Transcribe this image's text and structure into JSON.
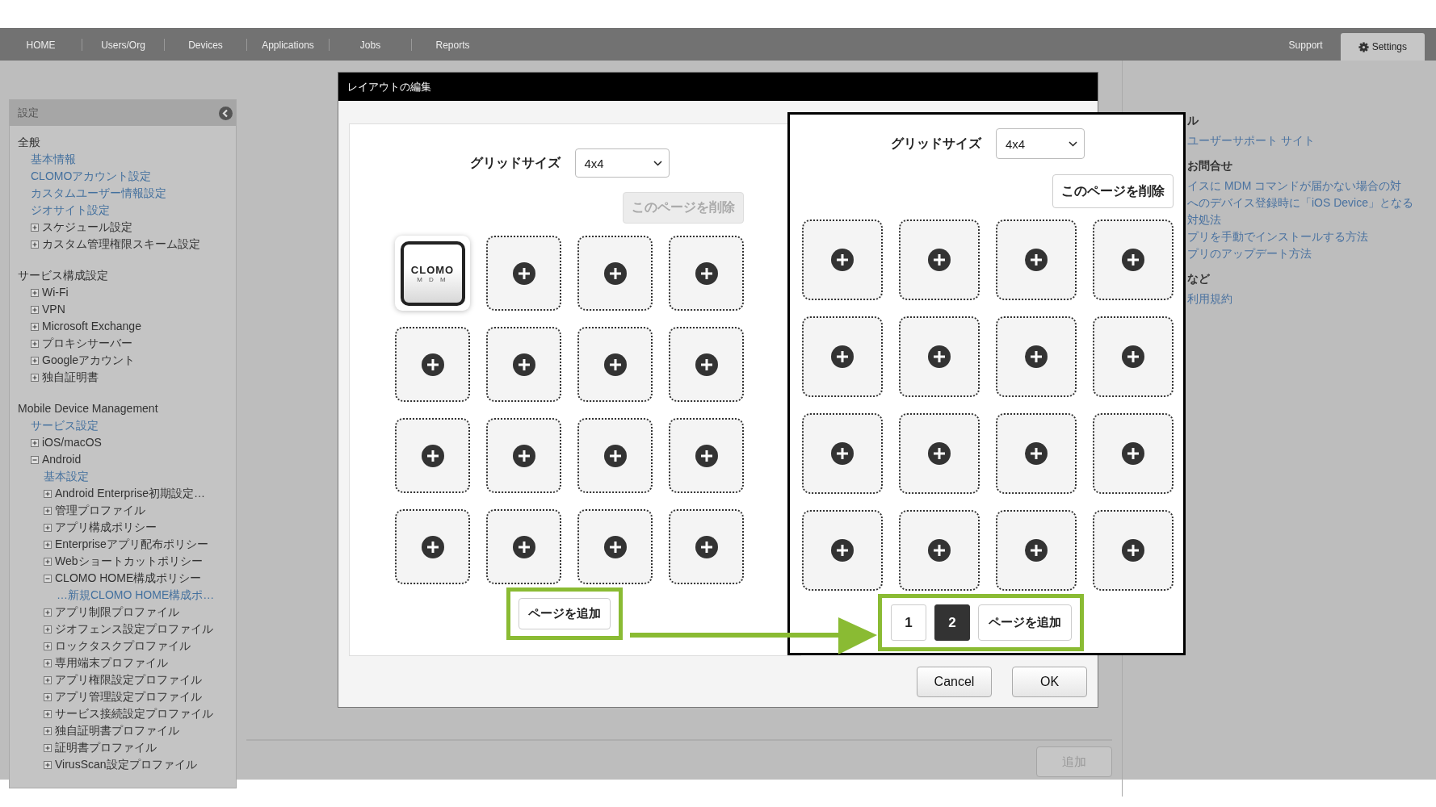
{
  "nav": {
    "tabs": [
      {
        "label": "HOME",
        "selected": false
      },
      {
        "label": "Users/Org",
        "selected": false
      },
      {
        "label": "Devices",
        "selected": false
      },
      {
        "label": "Applications",
        "selected": false
      },
      {
        "label": "Jobs",
        "selected": false
      },
      {
        "label": "Reports",
        "selected": false
      }
    ],
    "right_tabs": [
      {
        "label": "Support",
        "selected": false,
        "kind": "text"
      },
      {
        "label": "Settings",
        "selected": true,
        "kind": "gear"
      }
    ]
  },
  "sidebar": {
    "title": "設定",
    "sections": [
      {
        "heading": "全般",
        "items": [
          {
            "kind": "link",
            "label": "基本情報"
          },
          {
            "kind": "link",
            "label": "CLOMOアカウント設定"
          },
          {
            "kind": "link",
            "label": "カスタムユーザー情報設定"
          },
          {
            "kind": "link",
            "label": "ジオサイト設定"
          },
          {
            "kind": "node",
            "label": "スケジュール設定",
            "expanded": false
          },
          {
            "kind": "node",
            "label": "カスタム管理権限スキーム設定",
            "expanded": false
          }
        ]
      },
      {
        "heading": "サービス構成設定",
        "items": [
          {
            "kind": "node",
            "label": "Wi-Fi",
            "expanded": false
          },
          {
            "kind": "node",
            "label": "VPN",
            "expanded": false
          },
          {
            "kind": "node",
            "label": "Microsoft Exchange",
            "expanded": false
          },
          {
            "kind": "node",
            "label": "プロキシサーバー",
            "expanded": false
          },
          {
            "kind": "node",
            "label": "Googleアカウント",
            "expanded": false
          },
          {
            "kind": "node",
            "label": "独自証明書",
            "expanded": false
          }
        ]
      },
      {
        "heading": "Mobile Device Management",
        "items": [
          {
            "kind": "link",
            "label": "サービス設定"
          },
          {
            "kind": "node",
            "label": "iOS/macOS",
            "expanded": false
          },
          {
            "kind": "node",
            "label": "Android",
            "expanded": true,
            "children": [
              {
                "kind": "link",
                "label": "基本設定"
              },
              {
                "kind": "node",
                "label": "Android Enterprise初期設定…",
                "expanded": false
              },
              {
                "kind": "node",
                "label": "管理プロファイル",
                "expanded": false
              },
              {
                "kind": "node",
                "label": "アプリ構成ポリシー",
                "expanded": false
              },
              {
                "kind": "node",
                "label": "Enterpriseアプリ配布ポリシー",
                "expanded": false
              },
              {
                "kind": "node",
                "label": "Webショートカットポリシー",
                "expanded": false
              },
              {
                "kind": "node",
                "label": "CLOMO HOME構成ポリシー",
                "expanded": true,
                "children": [
                  {
                    "kind": "link",
                    "label": "…新規CLOMO HOME構成ポ…"
                  }
                ]
              },
              {
                "kind": "node",
                "label": "アプリ制限プロファイル",
                "expanded": false
              },
              {
                "kind": "node",
                "label": "ジオフェンス設定プロファイル",
                "expanded": false
              },
              {
                "kind": "node",
                "label": "ロックタスクプロファイル",
                "expanded": false
              },
              {
                "kind": "node",
                "label": "専用端末プロファイル",
                "expanded": false
              },
              {
                "kind": "node",
                "label": "アプリ権限設定プロファイル",
                "expanded": false
              },
              {
                "kind": "node",
                "label": "アプリ管理設定プロファイル",
                "expanded": false
              },
              {
                "kind": "node",
                "label": "サービス接続設定プロファイル",
                "expanded": false
              },
              {
                "kind": "node",
                "label": "独自証明書プロファイル",
                "expanded": false
              },
              {
                "kind": "node",
                "label": "証明書プロファイル",
                "expanded": false
              },
              {
                "kind": "node",
                "label": "VirusScan設定プロファイル",
                "expanded": false
              }
            ]
          }
        ]
      }
    ]
  },
  "add_button": {
    "label": "追加",
    "disabled": true
  },
  "support_panel": {
    "sections": [
      {
        "heading": "ル",
        "links": [
          "ユーザーサポート サイト"
        ]
      },
      {
        "heading": "お問合せ",
        "links": [
          "イスに MDM コマンドが届かない場合の対",
          "へのデバイス登録時に「iOS Device」となる",
          "対処法",
          "プリを手動でインストールする方法",
          "プリのアップデート方法"
        ]
      },
      {
        "heading": "など",
        "links": [
          "利用規約"
        ]
      }
    ]
  },
  "dialog": {
    "title": "レイアウトの編集",
    "grid_size_label": "グリッドサイズ",
    "grid_size_value": "4x4",
    "delete_button": {
      "label": "このページを削除",
      "disabled": true
    },
    "tiles": [
      {
        "kind": "app",
        "logo": "CLOMO",
        "logo_sub": "M D M"
      },
      {
        "kind": "empty"
      },
      {
        "kind": "empty"
      },
      {
        "kind": "empty"
      },
      {
        "kind": "empty"
      },
      {
        "kind": "empty"
      },
      {
        "kind": "empty"
      },
      {
        "kind": "empty"
      },
      {
        "kind": "empty"
      },
      {
        "kind": "empty"
      },
      {
        "kind": "empty"
      },
      {
        "kind": "empty"
      },
      {
        "kind": "empty"
      },
      {
        "kind": "empty"
      },
      {
        "kind": "empty"
      },
      {
        "kind": "empty"
      }
    ],
    "add_page_button": "ページを追加",
    "buttons": [
      "Cancel",
      "OK"
    ]
  },
  "callout": {
    "grid_size_label": "グリッドサイズ",
    "grid_size_value": "4x4",
    "delete_button": {
      "label": "このページを削除",
      "disabled": false
    },
    "tiles": [
      {
        "kind": "empty"
      },
      {
        "kind": "empty"
      },
      {
        "kind": "empty"
      },
      {
        "kind": "empty"
      },
      {
        "kind": "empty"
      },
      {
        "kind": "empty"
      },
      {
        "kind": "empty"
      },
      {
        "kind": "empty"
      },
      {
        "kind": "empty"
      },
      {
        "kind": "empty"
      },
      {
        "kind": "empty"
      },
      {
        "kind": "empty"
      },
      {
        "kind": "empty"
      },
      {
        "kind": "empty"
      },
      {
        "kind": "empty"
      },
      {
        "kind": "empty"
      }
    ],
    "pages": [
      {
        "label": "1",
        "selected": false
      },
      {
        "label": "2",
        "selected": true
      }
    ],
    "add_page_button": "ページを追加"
  }
}
